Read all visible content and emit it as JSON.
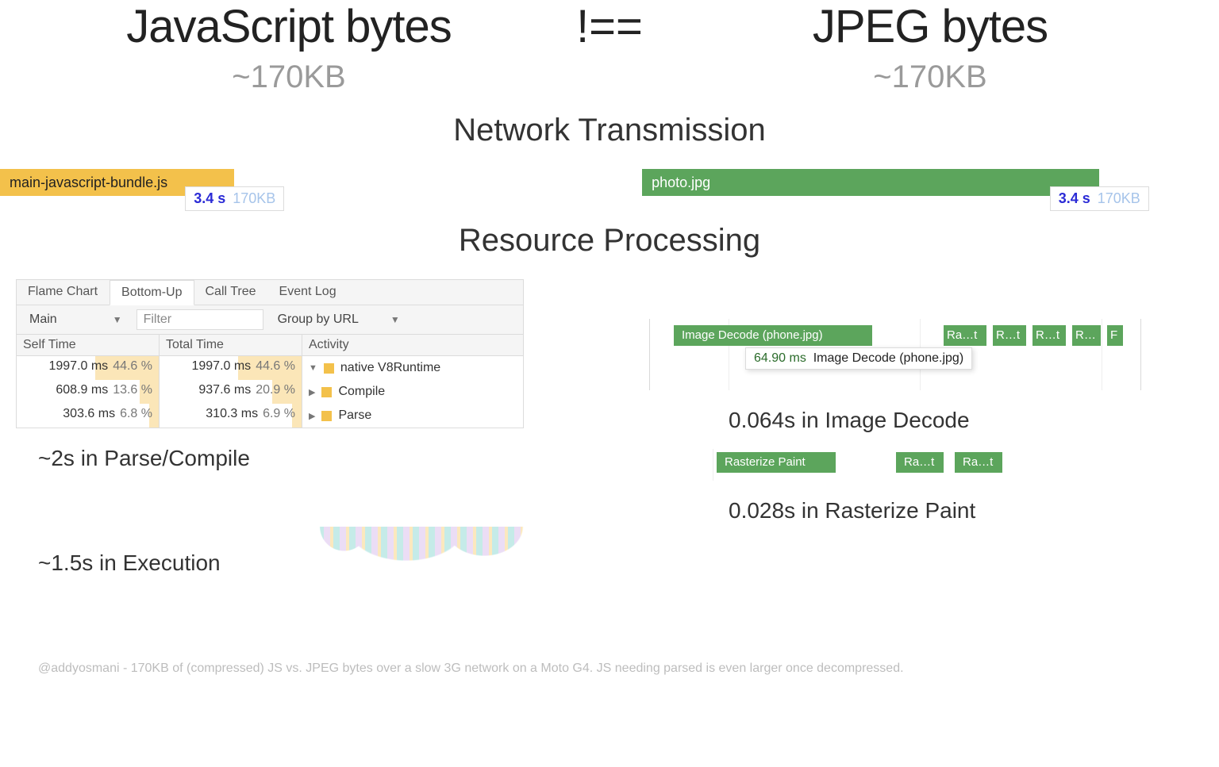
{
  "top": {
    "js_title": "JavaScript bytes",
    "js_size": "~170KB",
    "not_equal": "!==",
    "jpeg_title": "JPEG bytes",
    "jpeg_size": "~170KB"
  },
  "sections": {
    "network": "Network Transmission",
    "processing": "Resource Processing"
  },
  "network": {
    "js_file": "main-javascript-bundle.js",
    "jpg_file": "photo.jpg",
    "badge_time": "3.4 s",
    "badge_size": "170KB"
  },
  "devtools": {
    "tabs": [
      "Flame Chart",
      "Bottom-Up",
      "Call Tree",
      "Event Log"
    ],
    "active_tab": 1,
    "thread": "Main",
    "filter_placeholder": "Filter",
    "group_by": "Group by URL",
    "columns": [
      "Self Time",
      "Total Time",
      "Activity"
    ],
    "rows": [
      {
        "self_ms": "1997.0 ms",
        "self_pct": "44.6 %",
        "self_bar": 44.6,
        "total_ms": "1997.0 ms",
        "total_pct": "44.6 %",
        "total_bar": 44.6,
        "tri": "▼",
        "activity": "native V8Runtime"
      },
      {
        "self_ms": "608.9 ms",
        "self_pct": "13.6 %",
        "self_bar": 13.6,
        "total_ms": "937.6 ms",
        "total_pct": "20.9 %",
        "total_bar": 20.9,
        "tri": "▶",
        "activity": "Compile"
      },
      {
        "self_ms": "303.6 ms",
        "self_pct": "6.8 %",
        "self_bar": 6.8,
        "total_ms": "310.3 ms",
        "total_pct": "6.9 %",
        "total_bar": 6.9,
        "tri": "▶",
        "activity": "Parse"
      }
    ]
  },
  "image_decode": {
    "main_label": "Image Decode (phone.jpg)",
    "small": [
      "Ra…t",
      "R…t",
      "R…t",
      "R…",
      "F"
    ],
    "tooltip_ms": "64.90 ms",
    "tooltip_label": "Image Decode (phone.jpg)"
  },
  "raster": {
    "segments": [
      "Rasterize Paint",
      "Ra…t",
      "Ra…t"
    ]
  },
  "stats": {
    "js_parse": "~2s in Parse/Compile",
    "js_exec": "~1.5s in Execution",
    "decode": "0.064s in Image Decode",
    "raster": "0.028s in Rasterize Paint"
  },
  "footer": "@addyosmani - 170KB of (compressed) JS vs. JPEG bytes over a slow 3G network on a Moto G4. JS needing parsed is even larger once decompressed."
}
